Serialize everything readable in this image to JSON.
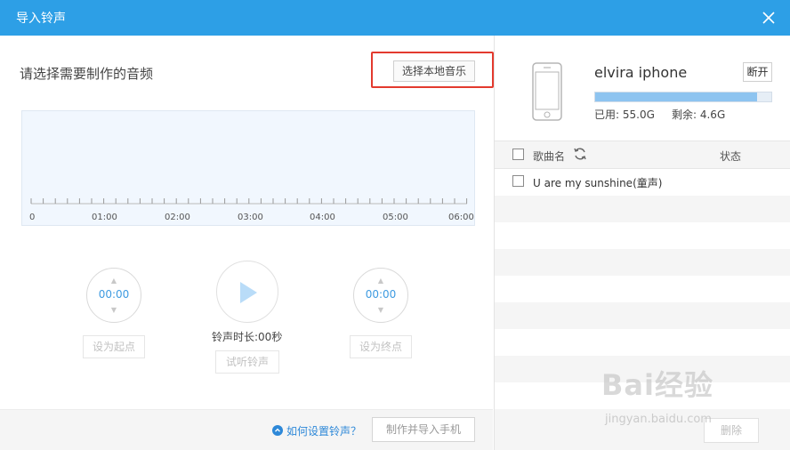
{
  "window": {
    "title": "导入铃声"
  },
  "left": {
    "heading": "请选择需要制作的音频",
    "choose_button": "选择本地音乐",
    "timeline_labels": [
      "0",
      "01:00",
      "02:00",
      "03:00",
      "04:00",
      "05:00",
      "06:00"
    ],
    "start_time": "00:00",
    "end_time": "00:00",
    "set_start_button": "设为起点",
    "set_end_button": "设为终点",
    "duration_text": "铃声时长:00秒",
    "preview_button": "试听铃声",
    "help_link": "如何设置铃声？",
    "make_button": "制作并导入手机"
  },
  "device": {
    "name": "elvira iphone",
    "disconnect_button": "断开",
    "used": "已用: 55.0G",
    "free": "剩余: 4.6G",
    "used_fraction": 0.92
  },
  "song_list": {
    "col_name": "歌曲名",
    "col_status": "状态",
    "rows": [
      {
        "title": "U are my sunshine(童声)",
        "status": ""
      }
    ]
  },
  "footer": {
    "delete_button": "删除"
  },
  "watermark": {
    "text": "Bai经验",
    "sub": "jingyan.baidu.com"
  },
  "colors": {
    "titlebar": "#2d9fe6",
    "accent": "#3e9be1",
    "highlight": "#e33a2e"
  },
  "icons": {
    "close": "close-icon",
    "play": "play-icon",
    "phone": "phone-icon",
    "refresh": "refresh-icon",
    "help": "help-circle-icon"
  }
}
